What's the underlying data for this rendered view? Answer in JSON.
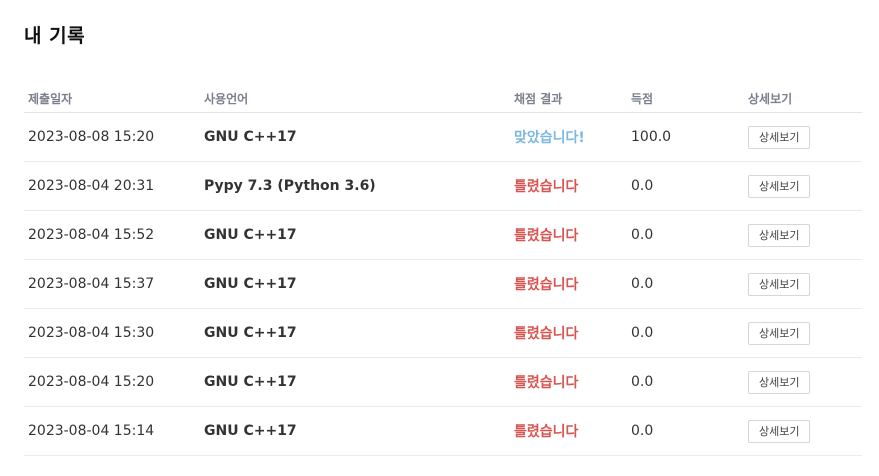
{
  "page": {
    "title": "내 기록"
  },
  "colors": {
    "accepted": "#7db8e0",
    "wrong": "#d9534f",
    "header_text": "#7a7f8c"
  },
  "table": {
    "headers": {
      "date": "제출일자",
      "language": "사용언어",
      "result": "채점 결과",
      "score": "득점",
      "detail": "상세보기"
    },
    "rows": [
      {
        "date": "2023-08-08 15:20",
        "language": "GNU C++17",
        "result": "맞았습니다!",
        "status": "accepted",
        "score": "100.0",
        "detail_label": "상세보기"
      },
      {
        "date": "2023-08-04 20:31",
        "language": "Pypy 7.3 (Python 3.6)",
        "result": "틀렸습니다",
        "status": "wrong",
        "score": "0.0",
        "detail_label": "상세보기"
      },
      {
        "date": "2023-08-04 15:52",
        "language": "GNU C++17",
        "result": "틀렸습니다",
        "status": "wrong",
        "score": "0.0",
        "detail_label": "상세보기"
      },
      {
        "date": "2023-08-04 15:37",
        "language": "GNU C++17",
        "result": "틀렸습니다",
        "status": "wrong",
        "score": "0.0",
        "detail_label": "상세보기"
      },
      {
        "date": "2023-08-04 15:30",
        "language": "GNU C++17",
        "result": "틀렸습니다",
        "status": "wrong",
        "score": "0.0",
        "detail_label": "상세보기"
      },
      {
        "date": "2023-08-04 15:20",
        "language": "GNU C++17",
        "result": "틀렸습니다",
        "status": "wrong",
        "score": "0.0",
        "detail_label": "상세보기"
      },
      {
        "date": "2023-08-04 15:14",
        "language": "GNU C++17",
        "result": "틀렸습니다",
        "status": "wrong",
        "score": "0.0",
        "detail_label": "상세보기"
      }
    ]
  }
}
